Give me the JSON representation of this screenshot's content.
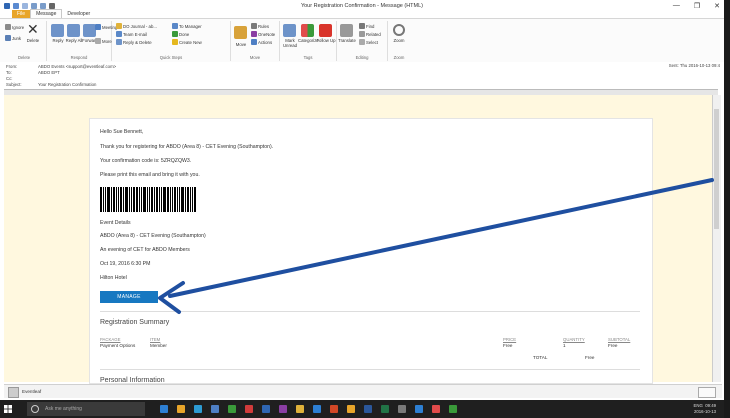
{
  "window": {
    "title": "Your Registration Confirmation - Message (HTML)",
    "minimize": "—",
    "restore": "❐",
    "close": "✕"
  },
  "ribbon_tabs": {
    "file": "File",
    "message": "Message",
    "developer": "Developer"
  },
  "ribbon": {
    "delete_group": {
      "ignore": "Ignore",
      "junk": "Junk",
      "delete": "Delete",
      "label": "Delete"
    },
    "respond_group": {
      "reply": "Reply",
      "reply_all": "Reply All",
      "forward": "Forward",
      "more": "More",
      "meeting": "Meeting",
      "label": "Respond"
    },
    "quick_steps": {
      "items": [
        "DO Journal - ab...",
        "Team E-mail",
        "Reply & Delete",
        "To Manager",
        "Done",
        "Create New"
      ],
      "label": "Quick Steps"
    },
    "move_group": {
      "move": "Move",
      "rules": "Rules",
      "onenote": "OneNote",
      "actions": "Actions",
      "label": "Move"
    },
    "tags_group": {
      "mark_unread": "Mark Unread",
      "categorize": "Categorize",
      "follow_up": "Follow Up",
      "label": "Tags"
    },
    "editing_group": {
      "translate": "Translate",
      "find": "Find",
      "related": "Related",
      "select": "Select",
      "label": "Editing"
    },
    "zoom_group": {
      "zoom": "Zoom",
      "label": "Zoom"
    }
  },
  "header": {
    "from_label": "From:",
    "from_value": "ABDO Events <support@eventleaf.com>",
    "to_label": "To:",
    "to_value": "ABDO EPT",
    "cc_label": "Cc:",
    "cc_value": "",
    "subject_label": "Subject:",
    "subject_value": "Your Registration Confirmation",
    "sent": "Sent:  Thu 2016-10-13 09:4"
  },
  "email": {
    "greeting": "Hello Sue Bennett,",
    "thanks": "Thank you for registering for ABDO (Area 8) - CET Evening (Southampton).",
    "code": "Your confirmation code is: 5ZRQZQW3.",
    "print": "Please print this email and bring it with you.",
    "event_details": "Event Details",
    "event_name": "ABDO (Area 8) - CET Evening (Southampton)",
    "event_desc": "An evening of CET for ABDO Members",
    "event_date": "Oct 19, 2016 6:30 PM",
    "venue": "Hilton Hotel",
    "manage_button": "MANAGE",
    "registration_summary": "Registration Summary",
    "table": {
      "headers": [
        "PACKAGE",
        "ITEM",
        "PRICE",
        "QUANTITY",
        "SUBTOTAL"
      ],
      "row": [
        "Payment Options",
        "Member",
        "Free",
        "1",
        "Free"
      ],
      "total_label": "TOTAL",
      "total_value": "Free"
    },
    "personal_information": "Personal Information"
  },
  "people_pane": {
    "name": "Eventleaf"
  },
  "taskbar": {
    "search_placeholder": "Ask me anything",
    "tray_lang": "ENG",
    "tray_time": "09:49",
    "tray_date": "2016-10-13"
  },
  "colors": {
    "accent": "#1778c1",
    "arrow": "#1f4fa0",
    "file_tab": "#e8a52a",
    "reading_bg": "#fff8df"
  }
}
